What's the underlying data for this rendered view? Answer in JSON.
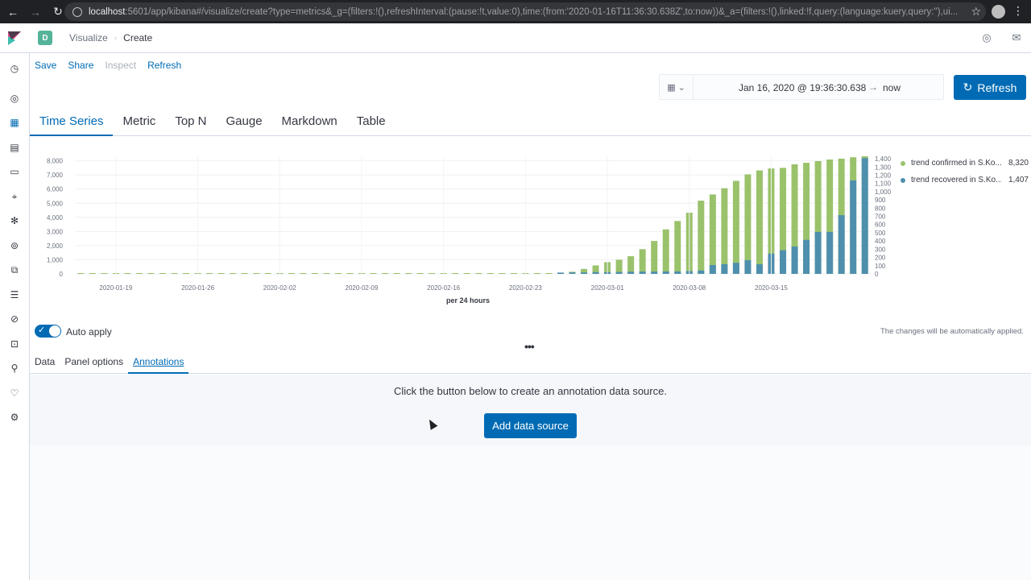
{
  "browser": {
    "url_host": "localhost",
    "url_rest": ":5601/app/kibana#/visualize/create?type=metrics&_g=(filters:!(),refreshInterval:(pause:!t,value:0),time:(from:'2020-01-16T11:36:30.638Z',to:now))&_a=(filters:!(),linked:!f,query:(language:kuery,query:''),ui..."
  },
  "header": {
    "space_initial": "D",
    "breadcrumbs": [
      "Visualize",
      "Create"
    ]
  },
  "top_menu": {
    "save": "Save",
    "share": "Share",
    "inspect": "Inspect",
    "refresh": "Refresh"
  },
  "time_picker": {
    "start": "Jan 16, 2020 @ 19:36:30.638",
    "arrow": "→",
    "end": "now",
    "refresh_label": "Refresh"
  },
  "vis_tabs": [
    "Time Series",
    "Metric",
    "Top N",
    "Gauge",
    "Markdown",
    "Table"
  ],
  "chart_data": {
    "type": "bar",
    "xlabel": "per 24 hours",
    "x_ticks": [
      "2020-01-19",
      "2020-01-26",
      "2020-02-02",
      "2020-02-09",
      "2020-02-16",
      "2020-02-23",
      "2020-03-01",
      "2020-03-08",
      "2020-03-15"
    ],
    "y_left_ticks": [
      "0",
      "1,000",
      "2,000",
      "3,000",
      "4,000",
      "5,000",
      "6,000",
      "7,000",
      "8,000"
    ],
    "y_right_ticks": [
      "0",
      "100",
      "200",
      "300",
      "400",
      "500",
      "600",
      "700",
      "800",
      "900",
      "1,000",
      "1,100",
      "1,200",
      "1,300",
      "1,400"
    ],
    "ylim_left": [
      0,
      8320
    ],
    "ylim_right": [
      0,
      1430
    ],
    "series": [
      {
        "name": "trend confirmed in S.Ko...",
        "color": "#9ac26b",
        "last_value": "8,320",
        "values": [
          0,
          0,
          0,
          0,
          0,
          0,
          0,
          0,
          0,
          0,
          0,
          0,
          0,
          0,
          0,
          0,
          0,
          0,
          0,
          0,
          0,
          0,
          0,
          0,
          0,
          0,
          0,
          0,
          0,
          0,
          0,
          0,
          0,
          0,
          0,
          0,
          0,
          0,
          0,
          0,
          0,
          60,
          150,
          350,
          600,
          830,
          1000,
          1250,
          1750,
          2330,
          3150,
          3740,
          4330,
          5180,
          5620,
          6060,
          6580,
          7040,
          7320,
          7460,
          7500,
          7750,
          7860,
          7980,
          8090,
          8150,
          8250,
          8320
        ]
      },
      {
        "name": "trend recovered in S.Ko...",
        "color": "#4f8fae",
        "last_value": "1,407",
        "values": [
          0,
          0,
          0,
          0,
          0,
          0,
          0,
          0,
          0,
          0,
          0,
          0,
          0,
          0,
          0,
          0,
          0,
          0,
          0,
          0,
          0,
          0,
          0,
          0,
          0,
          0,
          0,
          0,
          0,
          0,
          0,
          0,
          0,
          0,
          0,
          0,
          0,
          0,
          0,
          0,
          0,
          16,
          18,
          18,
          22,
          22,
          24,
          27,
          28,
          28,
          30,
          30,
          34,
          41,
          108,
          118,
          135,
          166,
          118,
          247,
          288,
          333,
          414,
          510,
          510,
          714,
          1137,
          1407
        ]
      }
    ]
  },
  "editor": {
    "auto_apply_label": "Auto apply",
    "auto_apply_note": "The changes will be automatically applied.",
    "handle": "•••",
    "tabs": [
      "Data",
      "Panel options",
      "Annotations"
    ]
  },
  "annotations": {
    "message": "Click the button below to create an annotation data source.",
    "add_button": "Add data source"
  }
}
